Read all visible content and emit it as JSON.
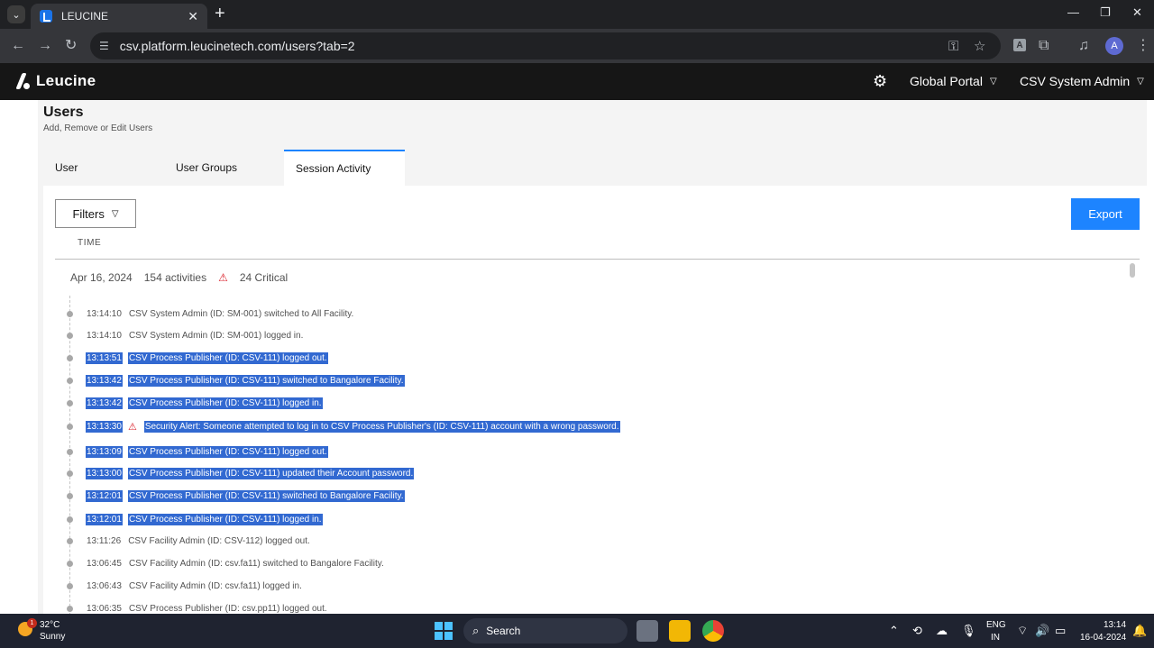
{
  "browser": {
    "tab_title": "LEUCINE",
    "url": "csv.platform.leucinetech.com/users?tab=2",
    "profile_initial": "A",
    "ext_initial": "A"
  },
  "header": {
    "brand": "Leucine",
    "portal": "Global Portal",
    "user": "CSV System Admin"
  },
  "page": {
    "title": "Users",
    "subtitle": "Add, Remove or Edit Users",
    "tabs": [
      {
        "label": "User"
      },
      {
        "label": "User Groups"
      },
      {
        "label": "Session Activity"
      }
    ],
    "filters_label": "Filters",
    "export_label": "Export",
    "time_header": "TIME",
    "date_group": {
      "date": "Apr 16, 2024",
      "activities": "154 activities",
      "critical": "24 Critical"
    },
    "entries": [
      {
        "time": "13:14:10",
        "text": "CSV System Admin (ID: SM-001) switched to All Facility.",
        "selected": false,
        "warn": false
      },
      {
        "time": "13:14:10",
        "text": "CSV System Admin (ID: SM-001) logged in.",
        "selected": false,
        "warn": false
      },
      {
        "time": "13:13:51",
        "text": "CSV Process Publisher (ID: CSV-111) logged out.",
        "selected": true,
        "warn": false
      },
      {
        "time": "13:13:42",
        "text": "CSV Process Publisher (ID: CSV-111) switched to Bangalore Facility.",
        "selected": true,
        "warn": false
      },
      {
        "time": "13:13:42",
        "text": "CSV Process Publisher (ID: CSV-111) logged in.",
        "selected": true,
        "warn": false
      },
      {
        "time": "13:13:30",
        "text": "Security Alert: Someone attempted to log in to CSV Process Publisher's (ID: CSV-111) account with a wrong password.",
        "selected": true,
        "warn": true
      },
      {
        "time": "13:13:09",
        "text": "CSV Process Publisher (ID: CSV-111) logged out.",
        "selected": true,
        "warn": false
      },
      {
        "time": "13:13:00",
        "text": "CSV Process Publisher (ID: CSV-111) updated their Account password.",
        "selected": true,
        "warn": false
      },
      {
        "time": "13:12:01",
        "text": "CSV Process Publisher (ID: CSV-111) switched to Bangalore Facility.",
        "selected": true,
        "warn": false
      },
      {
        "time": "13:12:01",
        "text": "CSV Process Publisher (ID: CSV-111) logged in.",
        "selected": true,
        "warn": false
      },
      {
        "time": "13:11:26",
        "text": "CSV Facility Admin (ID: CSV-112) logged out.",
        "selected": false,
        "warn": false
      },
      {
        "time": "13:06:45",
        "text": "CSV Facility Admin (ID: csv.fa11) switched to Bangalore Facility.",
        "selected": false,
        "warn": false
      },
      {
        "time": "13:06:43",
        "text": "CSV Facility Admin (ID: csv.fa11) logged in.",
        "selected": false,
        "warn": false
      },
      {
        "time": "13:06:35",
        "text": "CSV Process Publisher (ID: csv.pp11) logged out.",
        "selected": false,
        "warn": false
      }
    ]
  },
  "taskbar": {
    "weather_badge": "1",
    "temperature": "32°C",
    "condition": "Sunny",
    "search_label": "Search",
    "lang_line1": "ENG",
    "lang_line2": "IN",
    "time": "13:14",
    "date": "16-04-2024"
  }
}
